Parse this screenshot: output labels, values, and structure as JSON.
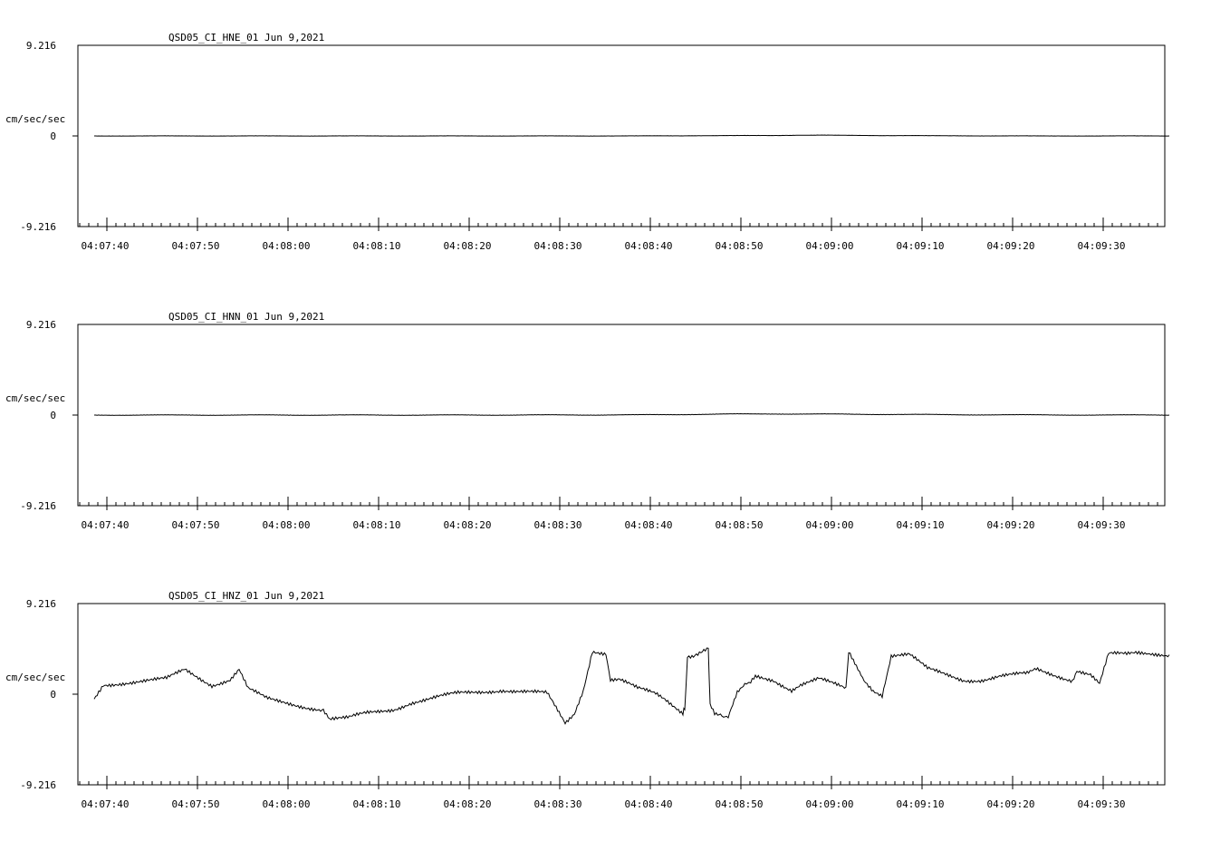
{
  "chart_data": [
    {
      "type": "line",
      "title": "QSD05_CI_HNE_01  Jun 9,2021",
      "ylabel": "cm/sec/sec",
      "ylim": [
        -9.216,
        9.216
      ],
      "ytick_labels": [
        "9.216",
        "0",
        "-9.216"
      ],
      "xlim": [
        "04:07:37",
        "04:09:37"
      ],
      "xtick_labels": [
        "04:07:40",
        "04:07:50",
        "04:08:00",
        "04:08:10",
        "04:08:20",
        "04:08:30",
        "04:08:40",
        "04:08:50",
        "04:09:00",
        "04:09:10",
        "04:09:20",
        "04:09:30"
      ],
      "series": [
        {
          "t": [
            0,
            20,
            40,
            60,
            75,
            80,
            85,
            100,
            118.7
          ],
          "y": [
            0,
            0,
            0,
            0,
            0.05,
            0.08,
            0.05,
            0,
            0
          ]
        }
      ]
    },
    {
      "type": "line",
      "title": "QSD05_CI_HNN_01  Jun 9,2021",
      "ylabel": "cm/sec/sec",
      "ylim": [
        -9.216,
        9.216
      ],
      "ytick_labels": [
        "9.216",
        "0",
        "-9.216"
      ],
      "xlim": [
        "04:07:37",
        "04:09:37"
      ],
      "xtick_labels": [
        "04:07:40",
        "04:07:50",
        "04:08:00",
        "04:08:10",
        "04:08:20",
        "04:08:30",
        "04:08:40",
        "04:08:50",
        "04:09:00",
        "04:09:10",
        "04:09:20",
        "04:09:30"
      ],
      "series": [
        {
          "t": [
            0,
            20,
            40,
            60,
            70,
            75,
            80,
            100,
            118.7
          ],
          "y": [
            0,
            0,
            0,
            0.02,
            0.1,
            0.12,
            0.1,
            0.02,
            0
          ]
        }
      ]
    },
    {
      "type": "line",
      "title": "QSD05_CI_HNZ_01  Jun 9,2021",
      "ylabel": "cm/sec/sec",
      "ylim": [
        -9.216,
        9.216
      ],
      "ytick_labels": [
        "9.216",
        "0",
        "-9.216"
      ],
      "xlim": [
        "04:07:37",
        "04:09:37"
      ],
      "xtick_labels": [
        "04:07:40",
        "04:07:50",
        "04:08:00",
        "04:08:10",
        "04:08:20",
        "04:08:30",
        "04:08:40",
        "04:08:50",
        "04:09:00",
        "04:09:10",
        "04:09:20",
        "04:09:30"
      ],
      "series": [
        {
          "t": [
            0,
            1,
            3,
            5,
            7,
            8,
            10,
            12,
            13,
            15,
            16,
            17,
            19,
            20,
            22,
            25,
            25.3,
            26,
            28,
            30,
            33,
            35,
            37,
            40,
            43,
            45,
            48,
            50,
            52,
            53,
            54,
            55,
            56.5,
            57,
            58,
            60,
            62,
            63,
            65,
            65.2,
            65.5,
            66,
            67.8,
            68,
            68.5,
            69,
            69.3,
            70,
            71,
            72,
            72.3,
            73,
            75,
            77,
            78,
            80,
            83,
            83.3,
            85,
            86,
            87,
            88,
            88.5,
            90,
            92,
            94,
            96,
            98,
            100,
            103,
            104,
            106,
            108,
            108.5,
            110,
            111,
            112,
            114,
            115,
            118.7
          ],
          "y": [
            -0.5,
            1.0,
            1.2,
            1.3,
            1.4,
            1.5,
            2.5,
            1.5,
            1.0,
            1.5,
            2.5,
            0.5,
            -0.5,
            -0.7,
            -1.0,
            -1.5,
            -1.8,
            -2.5,
            -2.5,
            -2.0,
            -1.5,
            -0.8,
            -0.5,
            0.0,
            0.3,
            0.5,
            0.2,
            0.0,
            -3.0,
            -2.0,
            0.5,
            4.5,
            4.2,
            1.5,
            1.5,
            0.5,
            0.0,
            -0.5,
            -1.8,
            -1.5,
            4.0,
            4.0,
            4.5,
            -1.0,
            -2.0,
            -2.2,
            -2.5,
            -2.5,
            0.0,
            1.0,
            1.2,
            1.8,
            1.5,
            0.5,
            1.0,
            1.5,
            0.5,
            4.5,
            1.5,
            0.5,
            0.0,
            4.0,
            4.0,
            4.0,
            2.5,
            2.0,
            1.5,
            1.5,
            1.8,
            2.0,
            2.5,
            2.0,
            1.5,
            2.5,
            2.0,
            1.0,
            4.0,
            4.0,
            4.2,
            4.0
          ]
        }
      ]
    }
  ]
}
